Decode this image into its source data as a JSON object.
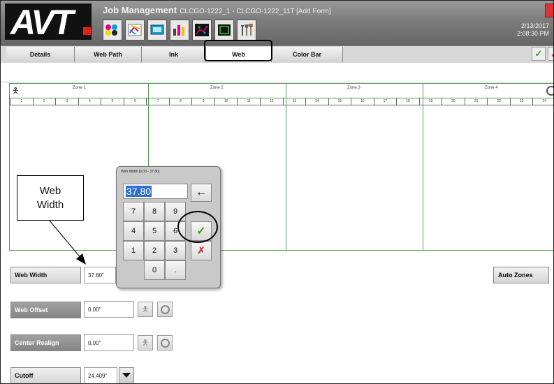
{
  "header": {
    "logo_text": "AVT",
    "title": "Job Management",
    "subtitle": "CLCGO-1222_1 - CLCGO-1222_11T [Add Form]",
    "date": "2/13/2017",
    "time": "2:08:30 PM",
    "tool_icons": [
      "ink-zones-icon",
      "register-icon",
      "monitor-icon",
      "bar-chart-icon",
      "scatter-plot-icon",
      "frame-icon",
      "tools-icon"
    ]
  },
  "tabs": [
    {
      "label": "Details"
    },
    {
      "label": "Web Path"
    },
    {
      "label": "Ink"
    },
    {
      "label": "Web"
    },
    {
      "label": "Color Bar"
    }
  ],
  "zones": [
    {
      "label": "Zone 1"
    },
    {
      "label": "Zone 2"
    },
    {
      "label": "Zone 3"
    },
    {
      "label": "Zone 4"
    }
  ],
  "keys": [
    "1",
    "2",
    "3",
    "4",
    "5",
    "6",
    "7",
    "8",
    "9",
    "10",
    "11",
    "12",
    "13",
    "14",
    "15",
    "16",
    "17",
    "18",
    "19",
    "20",
    "21",
    "22",
    "23",
    "24"
  ],
  "fields": {
    "web_width": {
      "label": "Web Width",
      "value": "37.80\""
    },
    "web_offset": {
      "label": "Web Offset",
      "value": "0.00\""
    },
    "center_realign": {
      "label": "Center Realign",
      "value": "0.00\""
    },
    "cutoff": {
      "label": "Cutoff",
      "value": "24.409\""
    },
    "auto_zones": {
      "label": "Auto Zones"
    }
  },
  "keypad": {
    "title": "Web Width  [0.00 - 37.80]",
    "value": "37.80",
    "keys": [
      "7",
      "8",
      "9",
      "4",
      "5",
      "6",
      "1",
      "2",
      "3",
      "0",
      "."
    ]
  },
  "annotation": {
    "line1": "Web",
    "line2": "Width"
  },
  "colors": {
    "zone_line": "#4e9e4e",
    "ok_check": "#3a9a1c",
    "cancel_x": "#c33333",
    "logo_dot": "#e32118",
    "selection": "#2e6fd2"
  }
}
